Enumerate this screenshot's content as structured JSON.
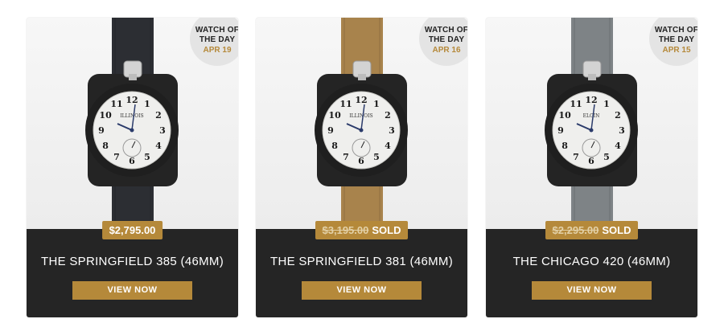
{
  "badge": {
    "line1": "WATCH OF",
    "line2": "THE DAY"
  },
  "dial_numerals": [
    "12",
    "1",
    "2",
    "3",
    "4",
    "5",
    "6",
    "7",
    "8",
    "9",
    "10",
    "11"
  ],
  "cards": [
    {
      "date": "APR 19",
      "price": "$2,795.00",
      "sold_label": "",
      "title": "THE SPRINGFIELD 385 (46MM)",
      "button": "VIEW NOW",
      "strap_color": "#2c2e33",
      "dial_brand": "ILLINOIS"
    },
    {
      "date": "APR 16",
      "price": "$3,195.00",
      "sold_label": "SOLD",
      "title": "THE SPRINGFIELD 381 (46MM)",
      "button": "VIEW NOW",
      "strap_color": "#a8834c",
      "dial_brand": "ILLINOIS"
    },
    {
      "date": "APR 15",
      "price": "$2,295.00",
      "sold_label": "SOLD",
      "title": "THE CHICAGO 420 (46MM)",
      "button": "VIEW NOW",
      "strap_color": "#7e8386",
      "dial_brand": "ELGIN"
    }
  ]
}
